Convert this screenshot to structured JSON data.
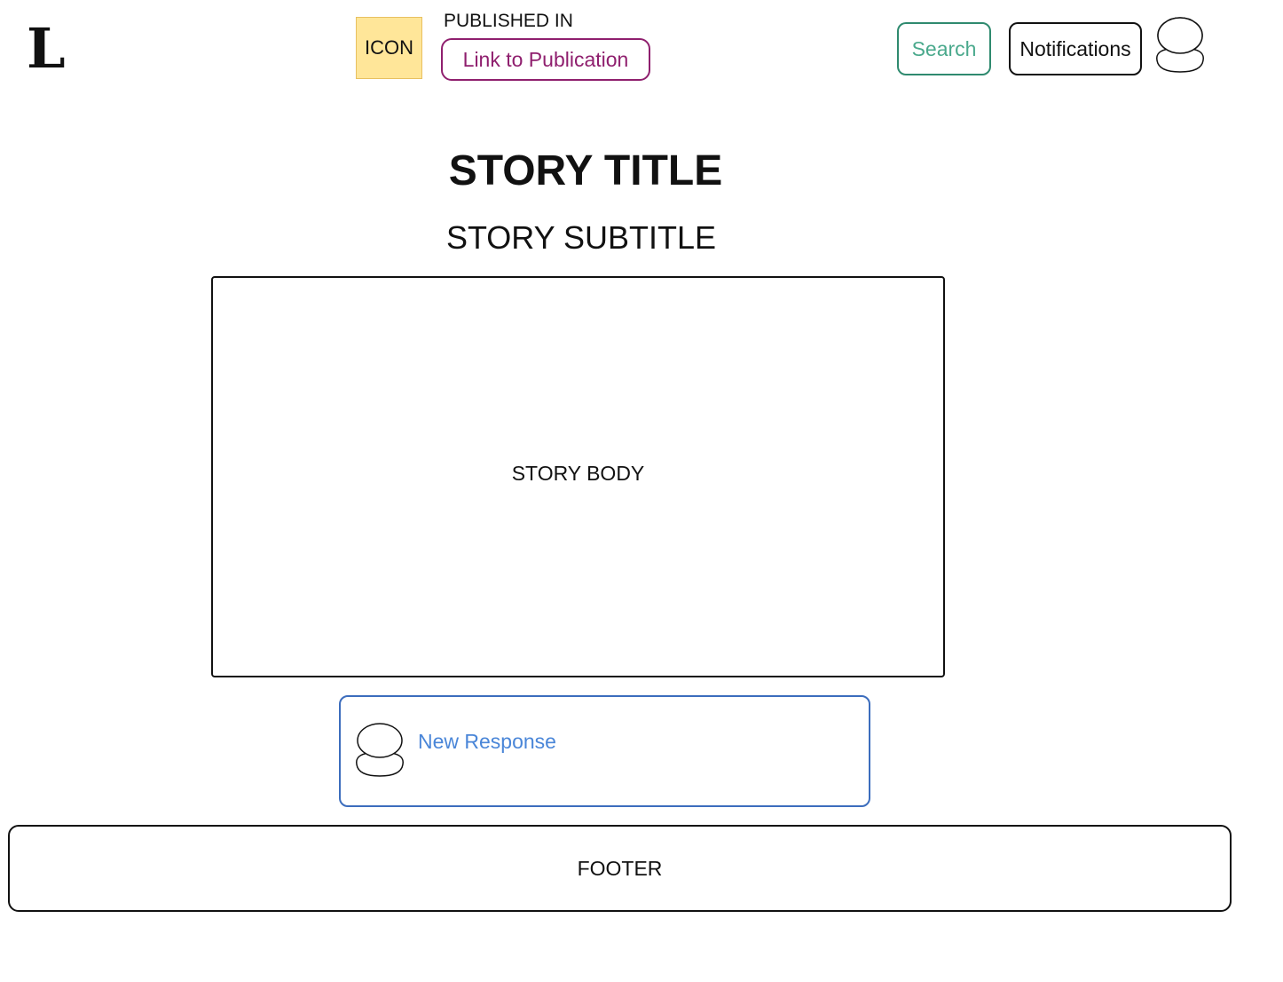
{
  "header": {
    "logo_text": "L",
    "publication": {
      "icon_label": "ICON",
      "published_in_label": "PUBLISHED IN",
      "link_label": "Link to Publication"
    },
    "search_label": "Search",
    "notifications_label": "Notifications",
    "profile_icon": "user-avatar-icon"
  },
  "story": {
    "title": "STORY TITLE",
    "subtitle": "STORY SUBTITLE",
    "body": "STORY BODY"
  },
  "responses": {
    "new_response_label": "New Response",
    "avatar_icon": "user-avatar-icon"
  },
  "footer": {
    "label": "FOOTER"
  },
  "colors": {
    "publication_link": "#8f1f6e",
    "search_border": "#2f8a6f",
    "search_text": "#4aa98c",
    "response_border": "#3c6dbd",
    "response_text": "#4a86d8",
    "icon_fill": "#ffe699"
  }
}
